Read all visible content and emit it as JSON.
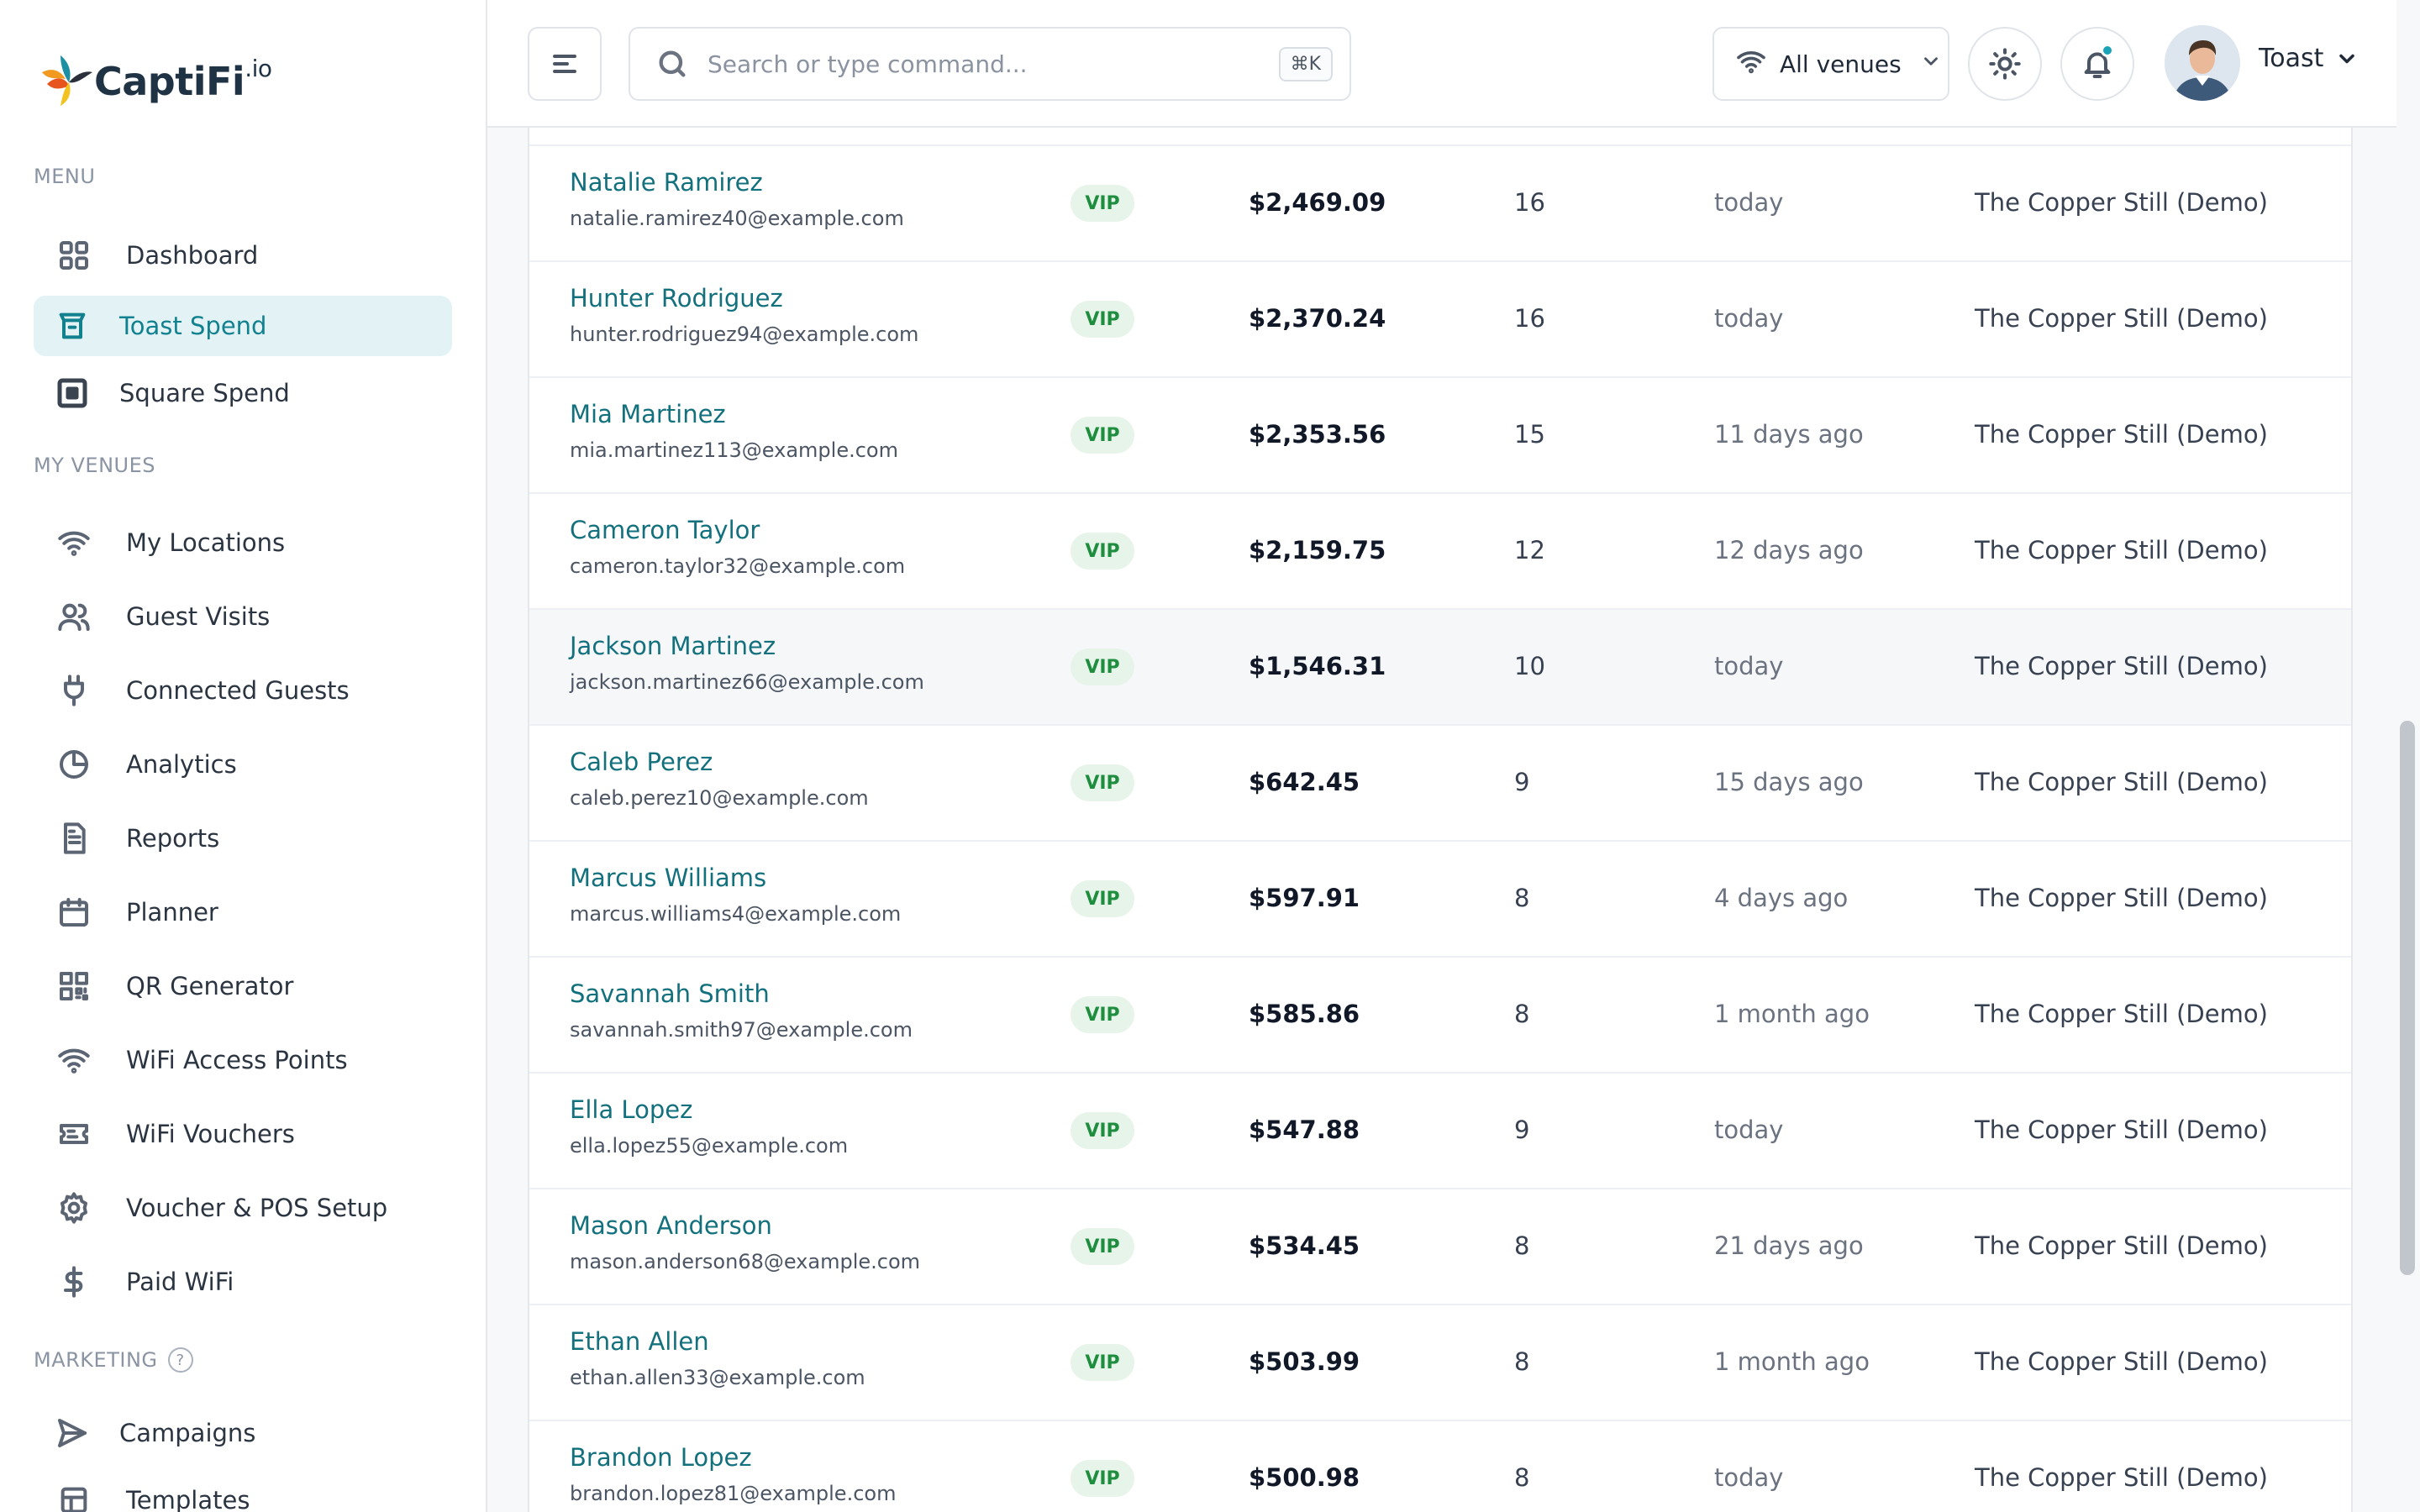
{
  "app": {
    "logo_name": "CaptiFi",
    "logo_suffix": ".io"
  },
  "sidebar": {
    "menu_label": "MENU",
    "venues_label": "MY VENUES",
    "marketing_label": "MARKETING",
    "marketing_help": "?",
    "menu_items": [
      {
        "label": "Dashboard",
        "icon": "grid-icon"
      },
      {
        "label": "Toast Spend",
        "icon": "toast-icon",
        "active": true
      },
      {
        "label": "Square Spend",
        "icon": "square-icon"
      }
    ],
    "venue_items": [
      {
        "label": "My Locations",
        "icon": "wifi-icon"
      },
      {
        "label": "Guest Visits",
        "icon": "users-icon"
      },
      {
        "label": "Connected Guests",
        "icon": "plug-icon"
      },
      {
        "label": "Analytics",
        "icon": "pie-chart-icon"
      },
      {
        "label": "Reports",
        "icon": "document-icon"
      },
      {
        "label": "Planner",
        "icon": "calendar-icon"
      },
      {
        "label": "QR Generator",
        "icon": "qr-code-icon"
      },
      {
        "label": "WiFi Access Points",
        "icon": "wifi-icon"
      },
      {
        "label": "WiFi Vouchers",
        "icon": "ticket-icon"
      },
      {
        "label": "Voucher & POS Setup",
        "icon": "gear-icon"
      },
      {
        "label": "Paid WiFi",
        "icon": "dollar-icon"
      }
    ],
    "marketing_items": [
      {
        "label": "Campaigns",
        "icon": "send-icon"
      },
      {
        "label": "Templates",
        "icon": "template-icon"
      }
    ]
  },
  "header": {
    "search_placeholder": "Search or type command...",
    "search_shortcut": "⌘K",
    "venue_select": "All venues",
    "user_name": "Toast"
  },
  "colors": {
    "accent": "#12818f",
    "vip_bg": "#e6f4ea",
    "vip_text": "#1e8e3e"
  },
  "table": {
    "rows": [
      {
        "name": "Natalie Ramirez",
        "email": "natalie.ramirez40@example.com",
        "tier": "VIP",
        "spend": "$2,469.09",
        "visits": "16",
        "last_visit": "today",
        "venue": "The Copper Still (Demo)"
      },
      {
        "name": "Hunter Rodriguez",
        "email": "hunter.rodriguez94@example.com",
        "tier": "VIP",
        "spend": "$2,370.24",
        "visits": "16",
        "last_visit": "today",
        "venue": "The Copper Still (Demo)"
      },
      {
        "name": "Mia Martinez",
        "email": "mia.martinez113@example.com",
        "tier": "VIP",
        "spend": "$2,353.56",
        "visits": "15",
        "last_visit": "11 days ago",
        "venue": "The Copper Still (Demo)"
      },
      {
        "name": "Cameron Taylor",
        "email": "cameron.taylor32@example.com",
        "tier": "VIP",
        "spend": "$2,159.75",
        "visits": "12",
        "last_visit": "12 days ago",
        "venue": "The Copper Still (Demo)"
      },
      {
        "name": "Jackson Martinez",
        "email": "jackson.martinez66@example.com",
        "tier": "VIP",
        "spend": "$1,546.31",
        "visits": "10",
        "last_visit": "today",
        "venue": "The Copper Still (Demo)"
      },
      {
        "name": "Caleb Perez",
        "email": "caleb.perez10@example.com",
        "tier": "VIP",
        "spend": "$642.45",
        "visits": "9",
        "last_visit": "15 days ago",
        "venue": "The Copper Still (Demo)"
      },
      {
        "name": "Marcus Williams",
        "email": "marcus.williams4@example.com",
        "tier": "VIP",
        "spend": "$597.91",
        "visits": "8",
        "last_visit": "4 days ago",
        "venue": "The Copper Still (Demo)"
      },
      {
        "name": "Savannah Smith",
        "email": "savannah.smith97@example.com",
        "tier": "VIP",
        "spend": "$585.86",
        "visits": "8",
        "last_visit": "1 month ago",
        "venue": "The Copper Still (Demo)"
      },
      {
        "name": "Ella Lopez",
        "email": "ella.lopez55@example.com",
        "tier": "VIP",
        "spend": "$547.88",
        "visits": "9",
        "last_visit": "today",
        "venue": "The Copper Still (Demo)"
      },
      {
        "name": "Mason Anderson",
        "email": "mason.anderson68@example.com",
        "tier": "VIP",
        "spend": "$534.45",
        "visits": "8",
        "last_visit": "21 days ago",
        "venue": "The Copper Still (Demo)"
      },
      {
        "name": "Ethan Allen",
        "email": "ethan.allen33@example.com",
        "tier": "VIP",
        "spend": "$503.99",
        "visits": "8",
        "last_visit": "1 month ago",
        "venue": "The Copper Still (Demo)"
      },
      {
        "name": "Brandon Lopez",
        "email": "brandon.lopez81@example.com",
        "tier": "VIP",
        "spend": "$500.98",
        "visits": "8",
        "last_visit": "today",
        "venue": "The Copper Still (Demo)"
      }
    ]
  }
}
